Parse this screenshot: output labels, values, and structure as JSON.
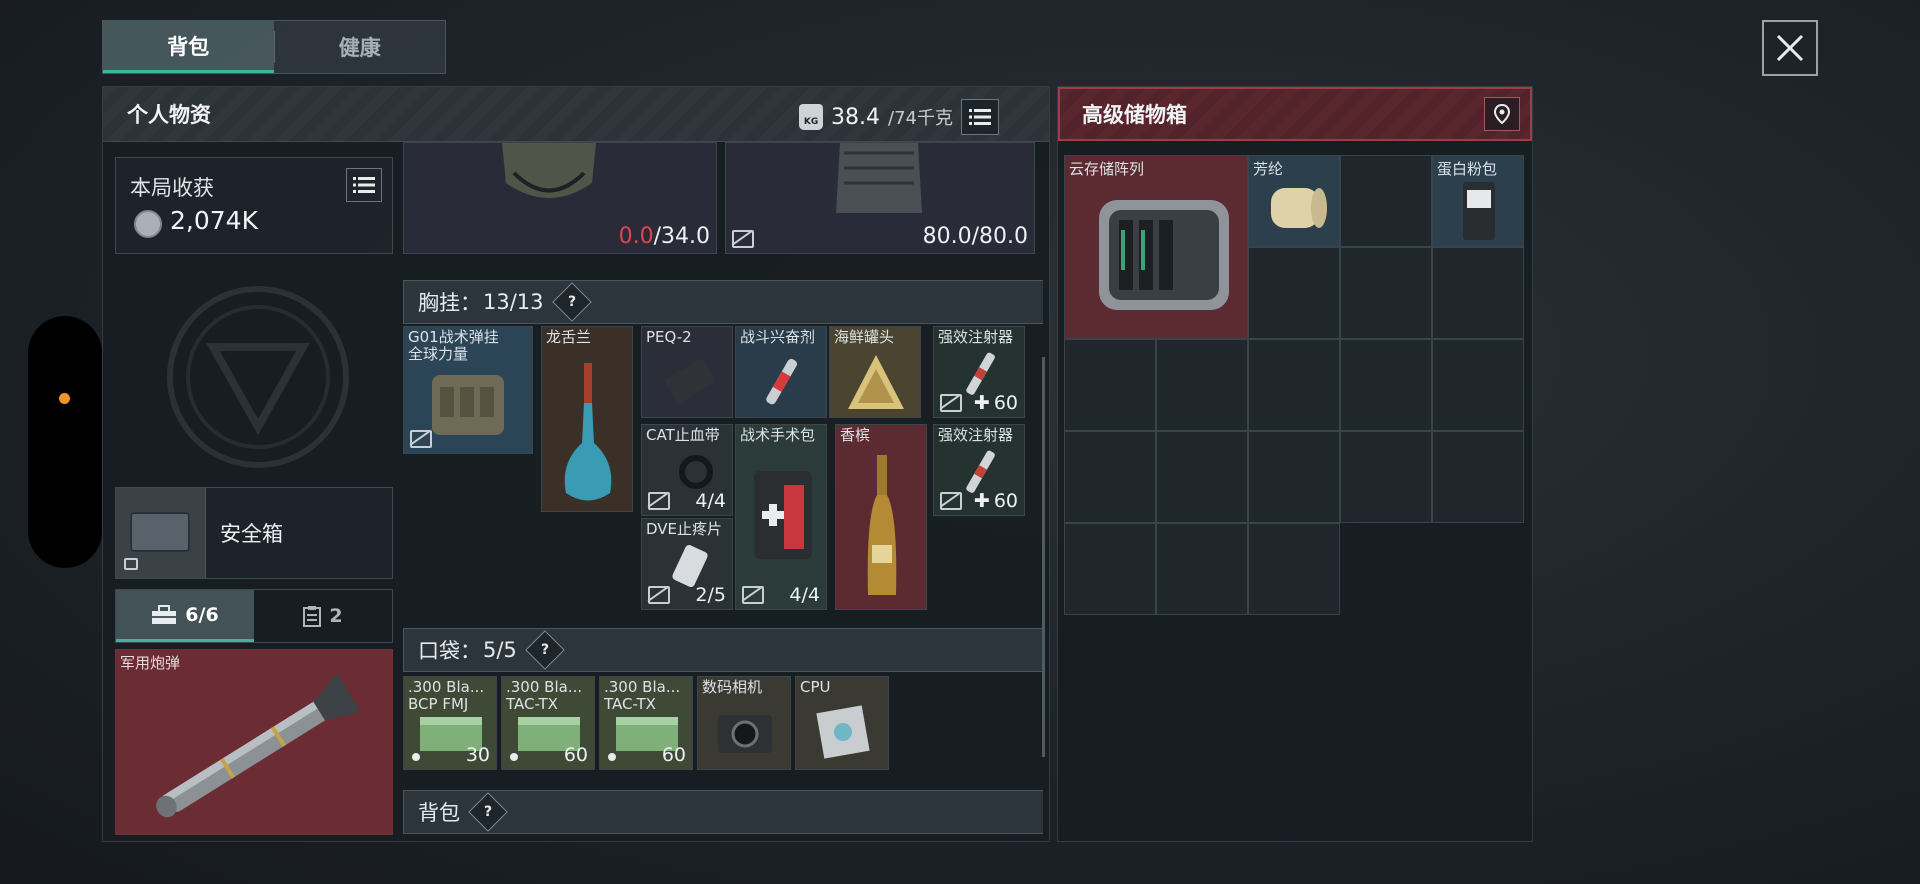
{
  "top_tabs": [
    "背包",
    "健康"
  ],
  "personal": {
    "title": "个人物资",
    "weight_current": "38.4",
    "weight_max": "/74千克",
    "kg_badge": "KG"
  },
  "harvest": {
    "title": "本局收获",
    "value": "2,074K"
  },
  "safe_box": {
    "label": "安全箱"
  },
  "slot_tabs": [
    {
      "icon": "toolbox-icon",
      "label": "6/6"
    },
    {
      "icon": "clipboard-icon",
      "label": "2"
    }
  ],
  "special_slot": {
    "name": "军用炮弹"
  },
  "gear": {
    "helmet": {
      "cur": "0.0",
      "max": "/34.0",
      "cur_color": "#e0454f"
    },
    "armor": {
      "value": "80.0/80.0"
    }
  },
  "chest_rig": {
    "label": "胸挂：",
    "count": "13/13",
    "items": [
      {
        "name": "G01战术弹挂",
        "sub": "全球力量",
        "qty": ""
      },
      {
        "name": "龙舌兰",
        "qty": ""
      },
      {
        "name": "PEQ-2",
        "qty": ""
      },
      {
        "name": "战斗兴奋剂",
        "qty": ""
      },
      {
        "name": "海鲜罐头",
        "qty": ""
      },
      {
        "name": "强效注射器",
        "qty": "60"
      },
      {
        "name": "CAT止血带",
        "qty": "4/4"
      },
      {
        "name": "战术手术包",
        "qty": "4/4"
      },
      {
        "name": "香槟",
        "qty": ""
      },
      {
        "name": "强效注射器",
        "qty": "60"
      },
      {
        "name": "DVE止疼片",
        "qty": "2/5"
      }
    ]
  },
  "pocket": {
    "label": "口袋：",
    "count": "5/5",
    "items": [
      {
        "name": ".300 Bla...",
        "sub": "BCP FMJ",
        "qty": "30"
      },
      {
        "name": ".300 Bla...",
        "sub": "TAC-TX",
        "qty": "60"
      },
      {
        "name": ".300 Bla...",
        "sub": "TAC-TX",
        "qty": "60"
      },
      {
        "name": "数码相机",
        "qty": ""
      },
      {
        "name": "CPU",
        "qty": ""
      }
    ]
  },
  "backpack_section": {
    "label": "背包"
  },
  "storage": {
    "title": "高级储物箱",
    "items": [
      {
        "name": "云存储阵列"
      },
      {
        "name": "芳纶"
      },
      {
        "name": "蛋白粉包"
      }
    ]
  },
  "colors": {
    "accent_teal": "#3fb39b",
    "red_highlight": "#a53a47",
    "dot_orange": "#f0932b"
  }
}
